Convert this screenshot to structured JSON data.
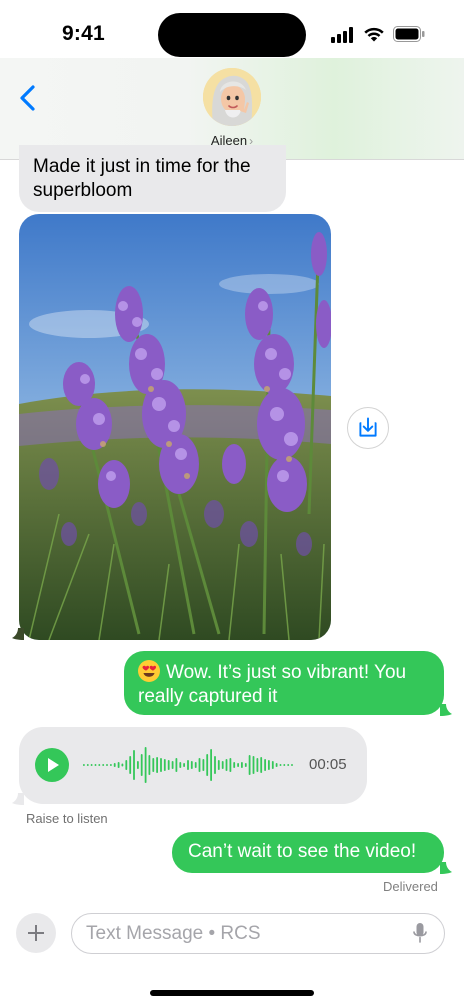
{
  "status_bar": {
    "time": "9:41",
    "icons": [
      "signal-icon",
      "wifi-icon",
      "battery-icon"
    ]
  },
  "header": {
    "contact_name": "Aileen",
    "chevron": "›",
    "back_icon": "chevron-left-icon"
  },
  "messages": [
    {
      "direction": "incoming",
      "type": "text",
      "text": "Made it just in time for the superbloom"
    },
    {
      "direction": "incoming",
      "type": "photo",
      "subject": "lavender",
      "action_icon": "save-download-icon"
    },
    {
      "direction": "outgoing",
      "type": "text",
      "emoji": "heart-eyes-emoji",
      "text": "Wow. It’s just so vibrant! You really captured it"
    },
    {
      "direction": "incoming",
      "type": "audio",
      "duration": "00:05",
      "footer": "Raise to listen"
    },
    {
      "direction": "outgoing",
      "type": "text",
      "text": "Can’t wait to see the video!",
      "status": "Delivered"
    }
  ],
  "composer": {
    "placeholder": "Text Message • RCS",
    "value": ""
  },
  "colors": {
    "outgoing_bubble": "#34c759",
    "incoming_bubble": "#e9e9eb",
    "accent": "#007aff"
  }
}
